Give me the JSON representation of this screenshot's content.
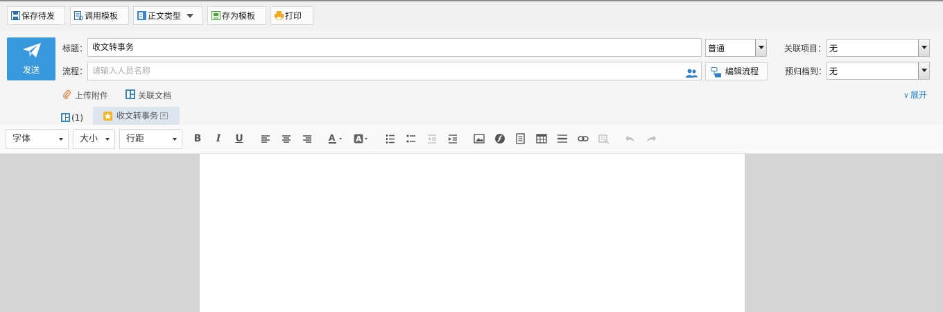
{
  "toolbar": {
    "save_draft": "保存待发",
    "use_template": "调用模板",
    "body_type": "正文类型",
    "save_as_template": "存为模板",
    "print": "打印"
  },
  "header": {
    "send_label": "发送",
    "title_label": "标题：",
    "title_value": "收文转事务",
    "priority_value": "普通",
    "related_project_label": "关联项目：",
    "related_project_value": "无",
    "flow_label": "流程：",
    "flow_placeholder": "请输入人员名称",
    "edit_flow_label": "编辑流程",
    "archive_label": "预归档到：",
    "archive_value": "无",
    "upload_attachment": "上传附件",
    "related_doc": "关联文档",
    "expand_label": "展开",
    "doc_count": "(1)",
    "doc_tab_label": "收文转事务"
  },
  "editor": {
    "font_label": "字体",
    "size_label": "大小",
    "line_spacing_label": "行距",
    "bold": "B",
    "italic": "I",
    "underline": "U"
  },
  "colors": {
    "send_button": "#3a98dc",
    "link_blue": "#2a7fc7",
    "doc_tab_bg": "#dde6ee",
    "canvas_gray": "#d4d5d7"
  }
}
